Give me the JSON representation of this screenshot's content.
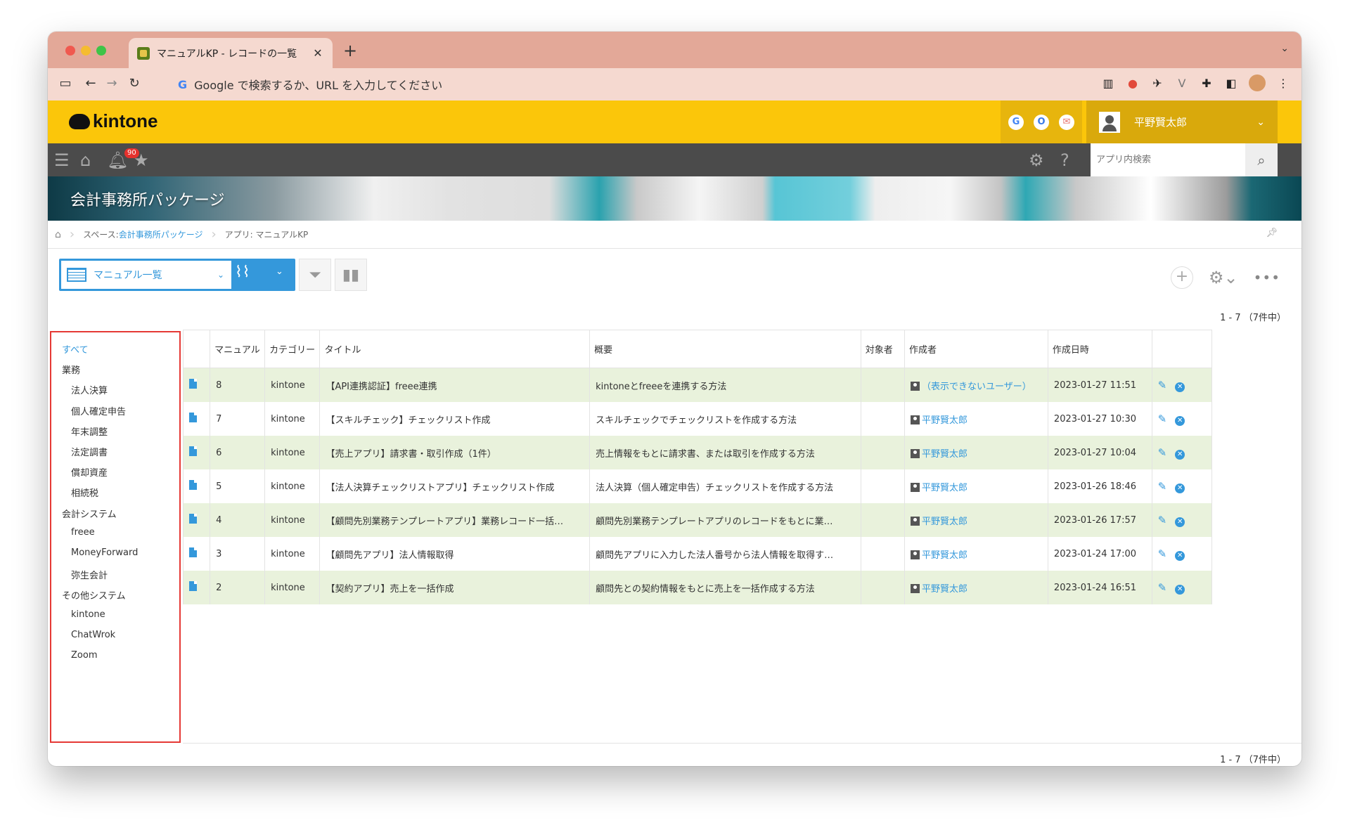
{
  "browser": {
    "tab_title": "マニュアルKP - レコードの一覧",
    "tab_close": "✕",
    "new_tab": "+",
    "omnibox_placeholder": "Google で検索するか、URL を入力してください"
  },
  "header": {
    "logo_text": "kintone",
    "user_name": "平野賢太郎",
    "services": [
      "G",
      "O",
      "✉"
    ]
  },
  "nav": {
    "notification_count": "90",
    "search_placeholder": "アプリ内検索"
  },
  "space": {
    "title": "会計事務所パッケージ"
  },
  "breadcrumb": {
    "space_prefix": "スペース: ",
    "space_name": "会計事務所パッケージ",
    "app_label": "アプリ: マニュアルKP"
  },
  "view": {
    "selected": "マニュアル一覧"
  },
  "pagination": {
    "top": "1 - 7 （7件中）",
    "bottom": "1 - 7 （7件中）"
  },
  "categories": [
    {
      "label": "すべて",
      "level": 0,
      "active": true
    },
    {
      "label": "業務",
      "level": 0
    },
    {
      "label": "法人決算",
      "level": 1
    },
    {
      "label": "個人確定申告",
      "level": 1
    },
    {
      "label": "年末調整",
      "level": 1
    },
    {
      "label": "法定調書",
      "level": 1
    },
    {
      "label": "償却資産",
      "level": 1
    },
    {
      "label": "相続税",
      "level": 1
    },
    {
      "label": "会計システム",
      "level": 0
    },
    {
      "label": "freee",
      "level": 1
    },
    {
      "label": "MoneyForward",
      "level": 1
    },
    {
      "label": "弥生会計",
      "level": 1
    },
    {
      "label": "その他システム",
      "level": 0
    },
    {
      "label": "kintone",
      "level": 1
    },
    {
      "label": "ChatWrok",
      "level": 1
    },
    {
      "label": "Zoom",
      "level": 1
    }
  ],
  "table": {
    "columns": [
      "マニュアル",
      "カテゴリー",
      "タイトル",
      "概要",
      "対象者",
      "作成者",
      "作成日時"
    ],
    "rows": [
      {
        "id": "8",
        "category": "kintone",
        "title": "【API連携認証】freee連携",
        "summary": "kintoneとfreeeを連携する方法",
        "target": "",
        "author": "（表示できないユーザー）",
        "created": "2023-01-27 11:51"
      },
      {
        "id": "7",
        "category": "kintone",
        "title": "【スキルチェック】チェックリスト作成",
        "summary": "スキルチェックでチェックリストを作成する方法",
        "target": "",
        "author": "平野賢太郎",
        "created": "2023-01-27 10:30"
      },
      {
        "id": "6",
        "category": "kintone",
        "title": "【売上アプリ】請求書・取引作成（1件）",
        "summary": "売上情報をもとに請求書、または取引を作成する方法",
        "target": "",
        "author": "平野賢太郎",
        "created": "2023-01-27 10:04"
      },
      {
        "id": "5",
        "category": "kintone",
        "title": "【法人決算チェックリストアプリ】チェックリスト作成",
        "summary": "法人決算（個人確定申告）チェックリストを作成する方法",
        "target": "",
        "author": "平野賢太郎",
        "created": "2023-01-26 18:46"
      },
      {
        "id": "4",
        "category": "kintone",
        "title": "【顧問先別業務テンプレートアプリ】業務レコード一括…",
        "summary": "顧問先別業務テンプレートアプリのレコードをもとに業…",
        "target": "",
        "author": "平野賢太郎",
        "created": "2023-01-26 17:57"
      },
      {
        "id": "3",
        "category": "kintone",
        "title": "【顧問先アプリ】法人情報取得",
        "summary": "顧問先アプリに入力した法人番号から法人情報を取得す…",
        "target": "",
        "author": "平野賢太郎",
        "created": "2023-01-24 17:00"
      },
      {
        "id": "2",
        "category": "kintone",
        "title": "【契約アプリ】売上を一括作成",
        "summary": "顧問先との契約情報をもとに売上を一括作成する方法",
        "target": "",
        "author": "平野賢太郎",
        "created": "2023-01-24 16:51"
      }
    ]
  }
}
